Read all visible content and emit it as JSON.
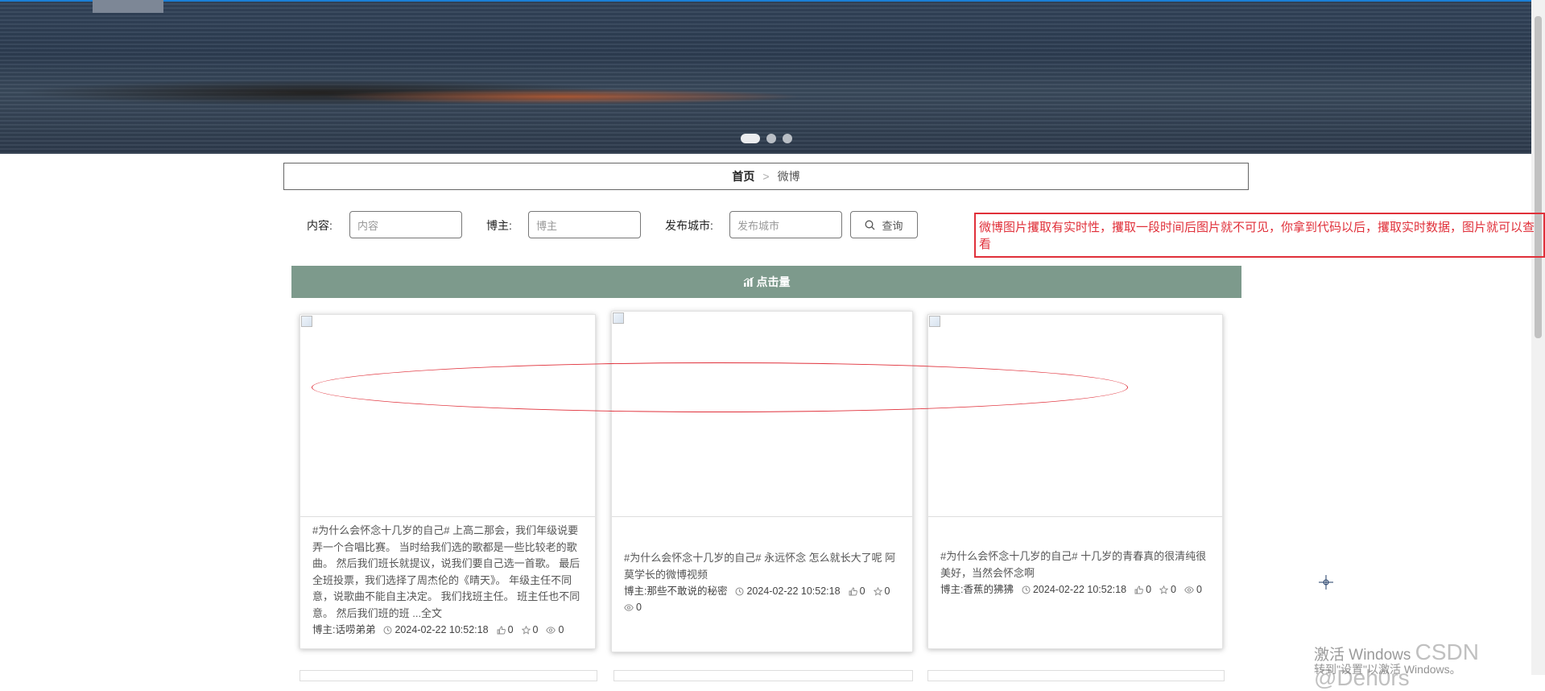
{
  "breadcrumb": {
    "home": "首页",
    "separator": ">",
    "current": "微博"
  },
  "filters": {
    "content": {
      "label": "内容:",
      "placeholder": "内容"
    },
    "blogger": {
      "label": "博主:",
      "placeholder": "博主"
    },
    "city": {
      "label": "发布城市:",
      "placeholder": "发布城市"
    },
    "search_button": "查询"
  },
  "annotation": "微博图片攫取有实时性，攫取一段时间后图片就不可见，你拿到代码以后，攫取实时数据，图片就可以查看",
  "click_bar_label": "点击量",
  "carousel": {
    "count": 3,
    "active_index": 0
  },
  "cards": [
    {
      "text": "#为什么会怀念十几岁的自己# 上高二那会，我们年级说要弄一个合唱比赛。 当时给我们选的歌都是一些比较老的歌曲。 然后我们班长就提议，说我们要自己选一首歌。 最后全班投票，我们选择了周杰伦的《晴天》。 年级主任不同意，说歌曲不能自主决定。 我们找班主任。 班主任也不同意。 然后我们班的班 ...全文",
      "author": "博主:话唠弟弟",
      "time": "2024-02-22 10:52:18",
      "likes": "0",
      "favs": "0",
      "views": "0"
    },
    {
      "text": "#为什么会怀念十几岁的自己# 永远怀念 怎么就长大了呢 阿莫学长的微博视频",
      "author": "博主:那些不敢说的秘密",
      "time": "2024-02-22 10:52:18",
      "likes": "0",
      "favs": "0",
      "views": "0"
    },
    {
      "text": "#为什么会怀念十几岁的自己# 十几岁的青春真的很清纯很美好，当然会怀念啊",
      "author": "博主:香蕉的狒狒",
      "time": "2024-02-22 10:52:18",
      "likes": "0",
      "favs": "0",
      "views": "0"
    }
  ],
  "watermark": {
    "line1": "激活 Windows",
    "overlay": "CSDN @Deh0rs",
    "line2": "转到\"设置\"以激活 Windows。"
  },
  "icons": [
    "search-icon",
    "chart-icon",
    "clock-icon",
    "thumbs-up-icon",
    "star-icon",
    "eye-icon",
    "broken-image-icon",
    "crosshair-icon"
  ],
  "colors": {
    "click_bar": "#7d9a8c",
    "annotation_red": "#e0303a"
  }
}
